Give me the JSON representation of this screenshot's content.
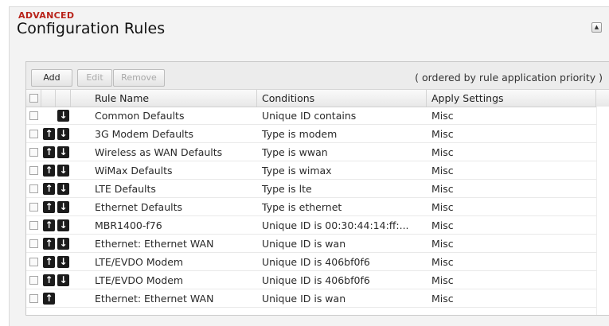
{
  "section": {
    "label": "ADVANCED",
    "title": "Configuration Rules",
    "collapse_icon": "collapse-up-icon"
  },
  "toolbar": {
    "add_label": "Add",
    "edit_label": "Edit",
    "remove_label": "Remove",
    "note": "( ordered by rule application priority )"
  },
  "table": {
    "columns": [
      "Rule Name",
      "Conditions",
      "Apply Settings"
    ],
    "rows": [
      {
        "name": "Common Defaults",
        "condition": "Unique ID contains",
        "apply": "Misc",
        "up": false,
        "down": true
      },
      {
        "name": "3G Modem Defaults",
        "condition": "Type is modem",
        "apply": "Misc",
        "up": true,
        "down": true
      },
      {
        "name": "Wireless as WAN Defaults",
        "condition": "Type is wwan",
        "apply": "Misc",
        "up": true,
        "down": true
      },
      {
        "name": "WiMax Defaults",
        "condition": "Type is wimax",
        "apply": "Misc",
        "up": true,
        "down": true
      },
      {
        "name": "LTE Defaults",
        "condition": "Type is lte",
        "apply": "Misc",
        "up": true,
        "down": true
      },
      {
        "name": "Ethernet Defaults",
        "condition": "Type is ethernet",
        "apply": "Misc",
        "up": true,
        "down": true
      },
      {
        "name": "MBR1400-f76",
        "condition": "Unique ID is 00:30:44:14:ff:...",
        "apply": "Misc",
        "up": true,
        "down": true
      },
      {
        "name": "Ethernet: Ethernet WAN",
        "condition": "Unique ID is wan",
        "apply": "Misc",
        "up": true,
        "down": true
      },
      {
        "name": "LTE/EVDO Modem",
        "condition": "Unique ID is 406bf0f6",
        "apply": "Misc",
        "up": true,
        "down": true
      },
      {
        "name": "LTE/EVDO Modem",
        "condition": "Unique ID is 406bf0f6",
        "apply": "Misc",
        "up": true,
        "down": true
      },
      {
        "name": "Ethernet: Ethernet WAN",
        "condition": "Unique ID is wan",
        "apply": "Misc",
        "up": true,
        "down": false
      }
    ]
  },
  "icons": {
    "up": "arrow-up-icon",
    "down": "arrow-down-icon"
  },
  "colors": {
    "section_label": "#b8231a",
    "arrow_button": "#1b1b1b"
  }
}
